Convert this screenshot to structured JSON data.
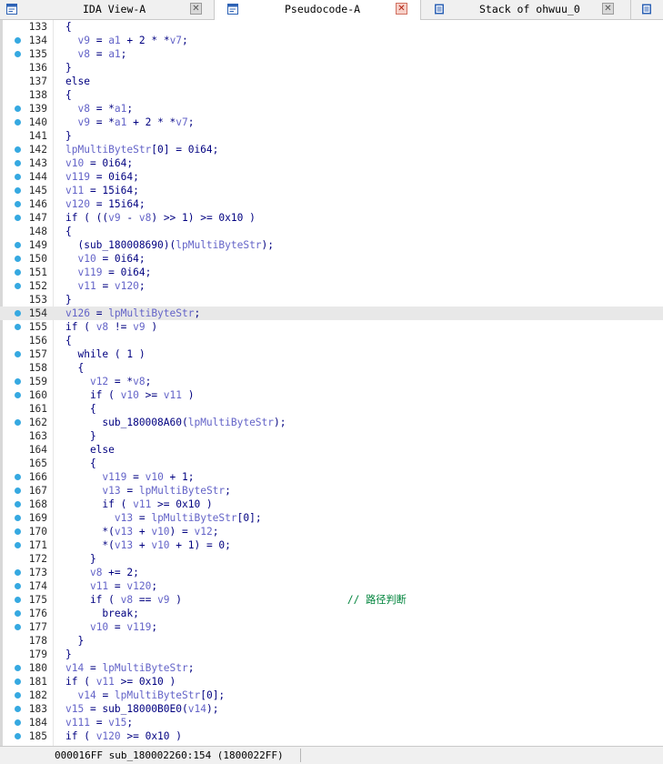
{
  "tabs": [
    {
      "label": "IDA View-A",
      "icon": "disassembly-view-icon",
      "active": false
    },
    {
      "label": "Pseudocode-A",
      "icon": "pseudocode-view-icon",
      "active": true
    },
    {
      "label": "Stack of ohwuu_0",
      "icon": "stack-view-icon",
      "active": false
    }
  ],
  "colors": {
    "accent": "#36a9e1",
    "keyword": "#000080",
    "variable": "#6464c8",
    "comment": "#00843c",
    "highlight": "#e8e8e8"
  },
  "code_lines": [
    {
      "num": "133",
      "dot": false,
      "hl": false,
      "text": "  {"
    },
    {
      "num": "134",
      "dot": true,
      "hl": false,
      "text": "    v9 = a1 + 2 * *v7;"
    },
    {
      "num": "135",
      "dot": true,
      "hl": false,
      "text": "    v8 = a1;"
    },
    {
      "num": "136",
      "dot": false,
      "hl": false,
      "text": "  }"
    },
    {
      "num": "137",
      "dot": false,
      "hl": false,
      "text": "  else"
    },
    {
      "num": "138",
      "dot": false,
      "hl": false,
      "text": "  {"
    },
    {
      "num": "139",
      "dot": true,
      "hl": false,
      "text": "    v8 = *a1;"
    },
    {
      "num": "140",
      "dot": true,
      "hl": false,
      "text": "    v9 = *a1 + 2 * *v7;"
    },
    {
      "num": "141",
      "dot": false,
      "hl": false,
      "text": "  }"
    },
    {
      "num": "142",
      "dot": true,
      "hl": false,
      "text": "  lpMultiByteStr[0] = 0i64;"
    },
    {
      "num": "143",
      "dot": true,
      "hl": false,
      "text": "  v10 = 0i64;"
    },
    {
      "num": "144",
      "dot": true,
      "hl": false,
      "text": "  v119 = 0i64;"
    },
    {
      "num": "145",
      "dot": true,
      "hl": false,
      "text": "  v11 = 15i64;"
    },
    {
      "num": "146",
      "dot": true,
      "hl": false,
      "text": "  v120 = 15i64;"
    },
    {
      "num": "147",
      "dot": true,
      "hl": false,
      "text": "  if ( ((v9 - v8) >> 1) >= 0x10 )"
    },
    {
      "num": "148",
      "dot": false,
      "hl": false,
      "text": "  {"
    },
    {
      "num": "149",
      "dot": true,
      "hl": false,
      "text": "    (sub_180008690)(lpMultiByteStr);"
    },
    {
      "num": "150",
      "dot": true,
      "hl": false,
      "text": "    v10 = 0i64;"
    },
    {
      "num": "151",
      "dot": true,
      "hl": false,
      "text": "    v119 = 0i64;"
    },
    {
      "num": "152",
      "dot": true,
      "hl": false,
      "text": "    v11 = v120;"
    },
    {
      "num": "153",
      "dot": false,
      "hl": false,
      "text": "  }"
    },
    {
      "num": "154",
      "dot": true,
      "hl": true,
      "text": "  v126 = lpMultiByteStr;"
    },
    {
      "num": "155",
      "dot": true,
      "hl": false,
      "text": "  if ( v8 != v9 )"
    },
    {
      "num": "156",
      "dot": false,
      "hl": false,
      "text": "  {"
    },
    {
      "num": "157",
      "dot": true,
      "hl": false,
      "text": "    while ( 1 )"
    },
    {
      "num": "158",
      "dot": false,
      "hl": false,
      "text": "    {"
    },
    {
      "num": "159",
      "dot": true,
      "hl": false,
      "text": "      v12 = *v8;"
    },
    {
      "num": "160",
      "dot": true,
      "hl": false,
      "text": "      if ( v10 >= v11 )"
    },
    {
      "num": "161",
      "dot": false,
      "hl": false,
      "text": "      {"
    },
    {
      "num": "162",
      "dot": true,
      "hl": false,
      "text": "        sub_180008A60(lpMultiByteStr);"
    },
    {
      "num": "163",
      "dot": false,
      "hl": false,
      "text": "      }"
    },
    {
      "num": "164",
      "dot": false,
      "hl": false,
      "text": "      else"
    },
    {
      "num": "165",
      "dot": false,
      "hl": false,
      "text": "      {"
    },
    {
      "num": "166",
      "dot": true,
      "hl": false,
      "text": "        v119 = v10 + 1;"
    },
    {
      "num": "167",
      "dot": true,
      "hl": false,
      "text": "        v13 = lpMultiByteStr;"
    },
    {
      "num": "168",
      "dot": true,
      "hl": false,
      "text": "        if ( v11 >= 0x10 )"
    },
    {
      "num": "169",
      "dot": true,
      "hl": false,
      "text": "          v13 = lpMultiByteStr[0];"
    },
    {
      "num": "170",
      "dot": true,
      "hl": false,
      "text": "        *(v13 + v10) = v12;"
    },
    {
      "num": "171",
      "dot": true,
      "hl": false,
      "text": "        *(v13 + v10 + 1) = 0;"
    },
    {
      "num": "172",
      "dot": false,
      "hl": false,
      "text": "      }"
    },
    {
      "num": "173",
      "dot": true,
      "hl": false,
      "text": "      v8 += 2;"
    },
    {
      "num": "174",
      "dot": true,
      "hl": false,
      "text": "      v11 = v120;"
    },
    {
      "num": "175",
      "dot": true,
      "hl": false,
      "text": "      if ( v8 == v9 )                           // 路径判断"
    },
    {
      "num": "176",
      "dot": true,
      "hl": false,
      "text": "        break;"
    },
    {
      "num": "177",
      "dot": true,
      "hl": false,
      "text": "      v10 = v119;"
    },
    {
      "num": "178",
      "dot": false,
      "hl": false,
      "text": "    }"
    },
    {
      "num": "179",
      "dot": false,
      "hl": false,
      "text": "  }"
    },
    {
      "num": "180",
      "dot": true,
      "hl": false,
      "text": "  v14 = lpMultiByteStr;"
    },
    {
      "num": "181",
      "dot": true,
      "hl": false,
      "text": "  if ( v11 >= 0x10 )"
    },
    {
      "num": "182",
      "dot": true,
      "hl": false,
      "text": "    v14 = lpMultiByteStr[0];"
    },
    {
      "num": "183",
      "dot": true,
      "hl": false,
      "text": "  v15 = sub_18000B0E0(v14);"
    },
    {
      "num": "184",
      "dot": true,
      "hl": false,
      "text": "  v111 = v15;"
    },
    {
      "num": "185",
      "dot": true,
      "hl": false,
      "text": "  if ( v120 >= 0x10 )"
    }
  ],
  "status": {
    "location": "000016FF sub_180002260:154 (1800022FF)"
  }
}
